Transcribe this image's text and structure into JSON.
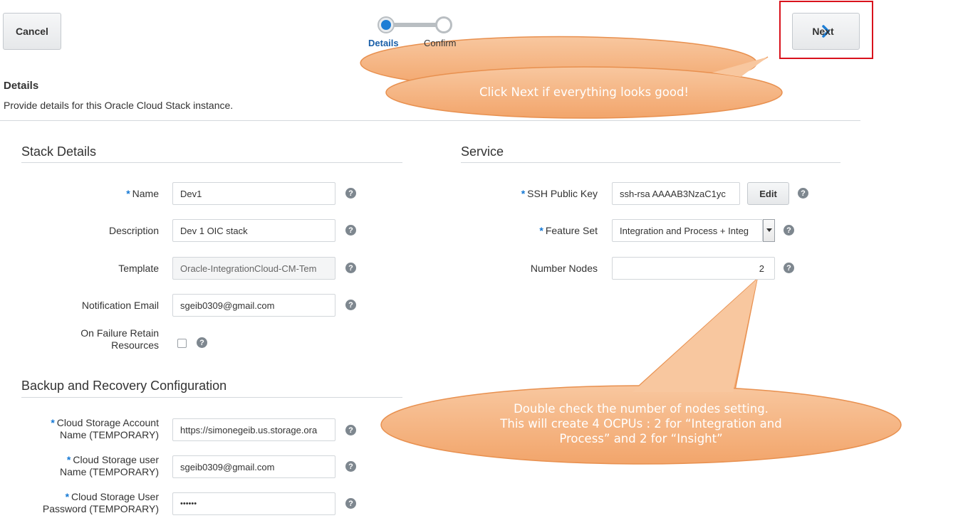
{
  "toolbar": {
    "cancel_label": "Cancel",
    "next_label": "Next",
    "train": [
      {
        "label": "Details",
        "state": "current"
      },
      {
        "label": "Confirm",
        "state": "upcoming"
      }
    ]
  },
  "page": {
    "title": "Details",
    "description": "Provide details for this Oracle Cloud Stack instance."
  },
  "stack_details": {
    "title": "Stack Details",
    "name_label": "Name",
    "name_value": "Dev1",
    "description_label": "Description",
    "description_value": "Dev 1 OIC stack",
    "template_label": "Template",
    "template_value": "Oracle-IntegrationCloud-CM-Tem",
    "email_label": "Notification Email",
    "email_value": "sgeib0309@gmail.com",
    "retain_label_line1": "On Failure Retain",
    "retain_label_line2": "Resources",
    "retain_checked": false
  },
  "backup": {
    "title": "Backup and Recovery Configuration",
    "account_label_line1": "Cloud Storage Account",
    "account_label_line2": "Name (TEMPORARY)",
    "account_value": "https://simonegeib.us.storage.ora",
    "user_label_line1": "Cloud Storage user",
    "user_label_line2": "Name (TEMPORARY)",
    "user_value": "sgeib0309@gmail.com",
    "password_label_line1": "Cloud Storage User",
    "password_label_line2": "Password (TEMPORARY)",
    "password_value": "••••••"
  },
  "service": {
    "title": "Service",
    "ssh_label": "SSH Public Key",
    "ssh_value": "ssh-rsa AAAAB3NzaC1yc",
    "edit_label": "Edit",
    "feature_label": "Feature Set",
    "feature_value": "Integration and Process + Integ",
    "nodes_label": "Number Nodes",
    "nodes_value": "2"
  },
  "callouts": {
    "next_hint": "Click Next if everything looks good!",
    "nodes_hint_line1": "Double check the number of nodes setting.",
    "nodes_hint_line2": "This will create 4 OCPUs : 2 for “Integration and",
    "nodes_hint_line3": "Process” and 2 for “Insight”"
  },
  "colors": {
    "accent": "#1e7ed5",
    "highlight_box": "#d9121c",
    "callout_fill": "#f4b183",
    "callout_stroke": "#e8904f"
  },
  "icons": {
    "help": "question-mark-circle",
    "next": "chevron-right"
  }
}
